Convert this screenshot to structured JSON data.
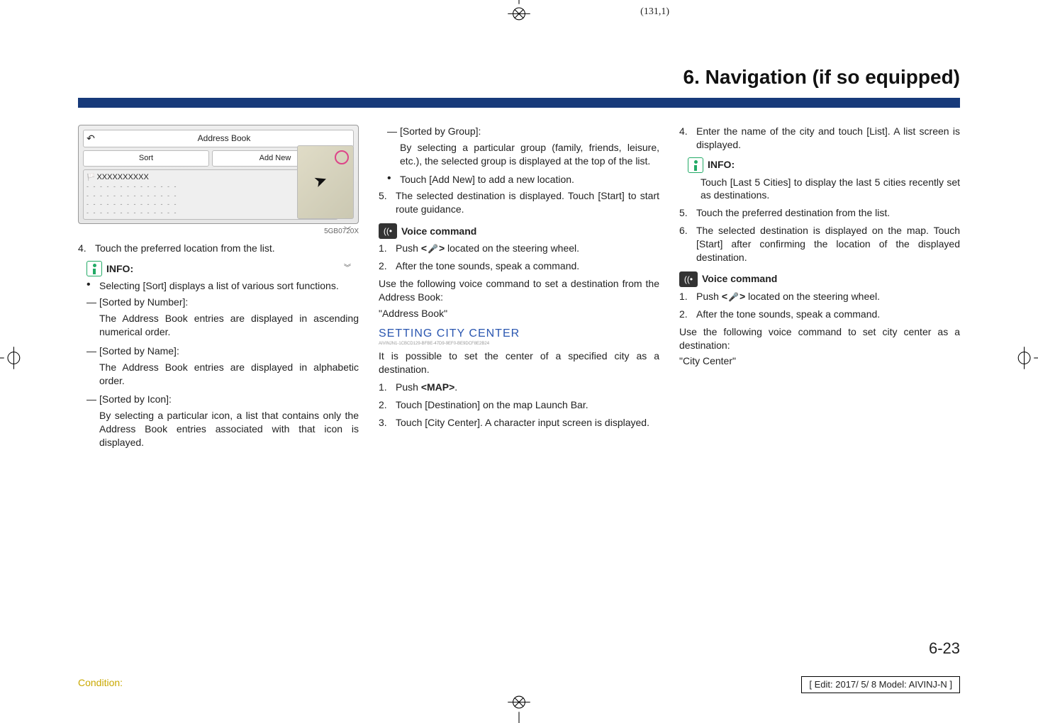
{
  "meta": {
    "page_coords": "(131,1)",
    "condition_label": "Condition:",
    "edit_label": "[ Edit: 2017/ 5/ 8    Model:  AIVINJ-N ]",
    "page_number": "6-23"
  },
  "chapter_title": "6. Navigation (if so equipped)",
  "screenshot": {
    "title": "Address Book",
    "sort_btn": "Sort",
    "addnew_btn": "Add New",
    "entry": "XXXXXXXXXX",
    "fig_id": "5GB0720X"
  },
  "col1": {
    "step4": "Touch the preferred location from the list.",
    "info_label": "INFO:",
    "bullet_sort": "Selecting [Sort] displays a list of various sort functions.",
    "by_number_h": "[Sorted by Number]:",
    "by_number_b": "The Address Book entries are displayed in ascending numerical order.",
    "by_name_h": "[Sorted by Name]:",
    "by_name_b": "The Address Book entries are displayed in alphabetic order.",
    "by_icon_h": "[Sorted by Icon]:",
    "by_icon_b": "By selecting a particular icon, a list that contains only the Address Book entries associated with that icon is displayed."
  },
  "col2": {
    "by_group_h": "[Sorted by Group]:",
    "by_group_b": "By selecting a particular group (family, friends, leisure, etc.), the selected group is displayed at the top of the list.",
    "addnew_bullet": "Touch [Add New] to add a new location.",
    "step5": "The selected destination is displayed. Touch [Start] to start route guidance.",
    "voice_label": "Voice command",
    "vc1_a": "Push ",
    "vc1_b": " located on the steering wheel.",
    "vc2": "After the tone sounds, speak a command.",
    "vc_intro": "Use the following voice command to set a destination from the Address Book:",
    "vc_phrase": "\"Address Book\"",
    "section_title": "SETTING CITY CENTER",
    "guid": "AIVINJN1-1CBCD129-BFBE-47D9-9EF0-BE9DCF8E2B24",
    "section_body": "It is possible to set the center of a specified city as a destination.",
    "cc_step1_a": "Push ",
    "cc_step1_b": "<MAP>",
    "cc_step1_c": ".",
    "cc_step2": "Touch [Destination] on the map Launch Bar.",
    "cc_step3": "Touch [City Center]. A character input screen is displayed."
  },
  "col3": {
    "step4": "Enter the name of the city and touch [List]. A list screen is displayed.",
    "info_label": "INFO:",
    "info_body": "Touch [Last 5 Cities] to display the last 5 cities recently set as destinations.",
    "step5": "Touch the preferred destination from the list.",
    "step6": "The selected destination is displayed on the map. Touch [Start] after confirming the location of the displayed destination.",
    "voice_label": "Voice command",
    "vc1_a": "Push ",
    "vc1_b": " located on the steering wheel.",
    "vc2": "After the tone sounds, speak a command.",
    "vc_intro": "Use the following voice command to set city center as a destination:",
    "vc_phrase": "\"City Center\""
  }
}
